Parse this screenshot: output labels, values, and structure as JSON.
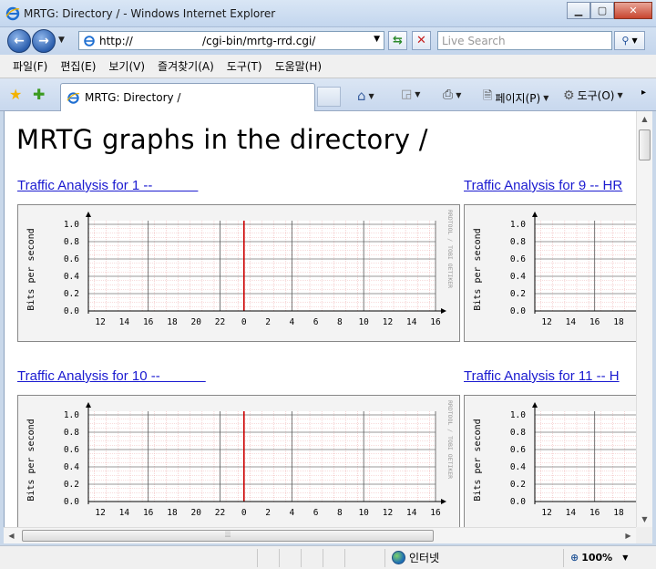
{
  "window": {
    "title": "MRTG: Directory / - Windows Internet Explorer"
  },
  "nav": {
    "address": "http://                    /cgi-bin/mrtg-rrd.cgi/",
    "search_placeholder": "Live Search"
  },
  "menu": [
    "파일(F)",
    "편집(E)",
    "보기(V)",
    "즐겨찾기(A)",
    "도구(T)",
    "도움말(H)"
  ],
  "tab": {
    "title": "MRTG: Directory /"
  },
  "commands": {
    "page": "페이지(P)",
    "tools": "도구(O)"
  },
  "page": {
    "heading": "MRTG graphs in the directory /",
    "links": [
      "Traffic Analysis for 1 --            ",
      "Traffic Analysis for 9 -- HR",
      "Traffic Analysis for 10 --            ",
      "Traffic Analysis for 11 -- H"
    ]
  },
  "graph": {
    "ylabel": "Bits per second",
    "watermark": "RRDTOOL / TOBI OETIKER",
    "x_ticks": [
      "12",
      "14",
      "16",
      "18",
      "20",
      "22",
      "0",
      "2",
      "4",
      "6",
      "8",
      "10",
      "12",
      "14",
      "16"
    ],
    "y_ticks": [
      "1.0",
      "0.8",
      "0.6",
      "0.4",
      "0.2",
      "0.0"
    ],
    "ylim": [
      0,
      1
    ],
    "now_marker_tick": "0",
    "now_color": "#cc0000"
  },
  "statusbar": {
    "zone": "인터넷",
    "zoom": "100%"
  }
}
